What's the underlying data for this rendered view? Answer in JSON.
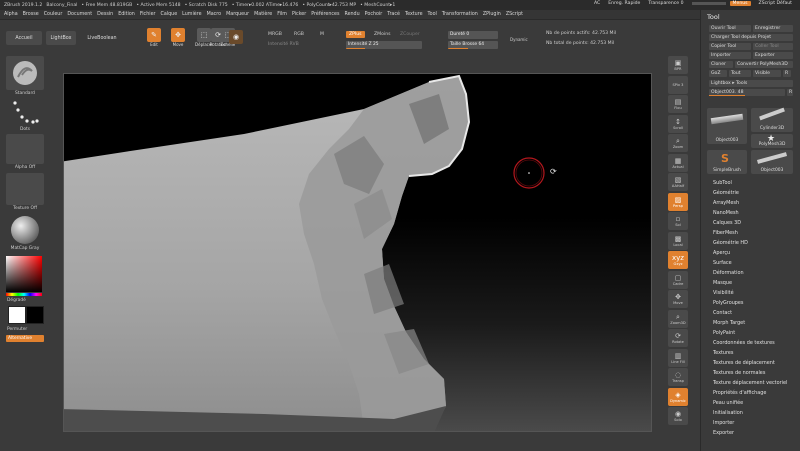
{
  "titlebar": {
    "app": "ZBrush 2019.1.2",
    "doc": "Balcony_Final",
    "free_mem": "• Free Mem 48.819GB",
    "active_mem": "• Active Mem 5148",
    "scratch": "• Scratch Disk 775",
    "timer": "• Timer▸0.002 ATime▸16.476",
    "polycount": "• PolyCount▸42.753 MP",
    "meshcount": "• MeshCount▸1",
    "ac": "AC",
    "quicksave": "Enreg. Rapide",
    "transparence": "Transparence 0",
    "transparence_value": 0,
    "menus": "Menus",
    "zscript": "ZScript Défaut"
  },
  "menubar": [
    "Alpha",
    "Brosse",
    "Couleur",
    "Document",
    "Dessin",
    "Edition",
    "Fichier",
    "Calque",
    "Lumière",
    "Macro",
    "Marqueur",
    "Matière",
    "Film",
    "Picker",
    "Préférences",
    "Rendu",
    "Pochoir",
    "Tracé",
    "Texture",
    "Tool",
    "Transformation",
    "ZPlugin",
    "ZScript"
  ],
  "toolbar": {
    "accueil": "Accueil",
    "lightbox": "LightBox",
    "livebool": "LiveBoolean",
    "icons": [
      {
        "label": "Edit",
        "glyph": "✎",
        "active": true
      },
      {
        "label": "Move",
        "glyph": "✥",
        "active": true
      },
      {
        "label": "Déplacer",
        "glyph": "⬚",
        "active": false
      },
      {
        "label": "Echelle",
        "glyph": "⬚",
        "active": false
      },
      {
        "label": "Rotation",
        "glyph": "⟳",
        "active": false
      }
    ],
    "mrgb": "MRGB",
    "rgb": "RGB",
    "m": "M",
    "intensite_rgb": "Intensité RVB",
    "zplus": "ZPlus",
    "zmoins": "ZMoins",
    "zcouper": "ZCouper",
    "intensite_z": "Intensité Z 25",
    "intensite_z_value": 0.25,
    "durete": "Dureté 0",
    "durete_value": 0,
    "taille": "Taille Brosse 64",
    "taille_value": 0.4,
    "dynamic": "Dynamic",
    "pts_actifs": "Nb de points actifs: 42.753 Mil",
    "pts_total": "Nb total de points: 42.753 Mil"
  },
  "leftpanel": {
    "standard": "Standard",
    "dots": "Dots",
    "alpha_off": "Alpha Off",
    "texture_off": "Texture Off",
    "matcap": "MatCap Gray",
    "gradient": "Dégradé",
    "permuter": "Permuter",
    "alternative": "Alternative"
  },
  "rightstrip": [
    {
      "label": "BPR",
      "glyph": "▣",
      "active": false
    },
    {
      "label": "SPix 3",
      "glyph": "",
      "active": false
    },
    {
      "label": "Flou",
      "glyph": "▤",
      "active": false
    },
    {
      "label": "Scroll",
      "glyph": "↕",
      "active": false
    },
    {
      "label": "Zoom",
      "glyph": "⌕",
      "active": false
    },
    {
      "label": "Actual",
      "glyph": "▦",
      "active": false
    },
    {
      "label": "AAHalf",
      "glyph": "▧",
      "active": false
    },
    {
      "label": "Persp",
      "glyph": "▨",
      "active": true
    },
    {
      "label": "Sol",
      "glyph": "▫",
      "active": false
    },
    {
      "label": "Local",
      "glyph": "▩",
      "active": false
    },
    {
      "label": "Gxyz",
      "glyph": "xyz",
      "active": true
    },
    {
      "label": "Cadre",
      "glyph": "▢",
      "active": false
    },
    {
      "label": "Move",
      "glyph": "✥",
      "active": false
    },
    {
      "label": "Zoom3D",
      "glyph": "⌕",
      "active": false
    },
    {
      "label": "Rotate",
      "glyph": "⟳",
      "active": false
    },
    {
      "label": "Line Fill",
      "glyph": "▥",
      "active": false
    },
    {
      "label": "Transp",
      "glyph": "◌",
      "active": false
    },
    {
      "label": "Dynamic",
      "glyph": "◈",
      "active": true
    },
    {
      "label": "Solo",
      "glyph": "◉",
      "active": false
    }
  ],
  "toolpanel": {
    "title": "Tool",
    "charger_outil": "Ouvrir Tool",
    "enregistrer": "Enregistrer",
    "charger_projet": "Charger Tool depuis Projet",
    "copier": "Copier Tool",
    "coller": "Coller Tool",
    "importer": "Importer",
    "exporter": "Exporter",
    "cloner": "Cloner",
    "convertir": "Convertir PolyMesh3D",
    "goz": "GoZ",
    "tout": "Tout",
    "visible": "Visible",
    "r": "R",
    "lightbox_tools": "Lightbox ▸ Tools",
    "object_slider": "Object003. 48",
    "object_slider_value": 0.48,
    "thumbs": [
      {
        "label": "Object003"
      },
      {
        "label": "Cylinder3D"
      },
      {
        "label": "PolyMesh3D"
      },
      {
        "label": "SimpleBrush"
      },
      {
        "label": "Object003"
      }
    ],
    "list": [
      "SubTool",
      "Géométrie",
      "ArrayMesh",
      "NanoMesh",
      "Calques 3D",
      "FiberMesh",
      "Géométrie HD",
      "Aperçu",
      "Surface",
      "Déformation",
      "Masque",
      "Visibilité",
      "PolyGroupes",
      "Contact",
      "Morph Target",
      "PolyPaint",
      "Coordonnées de textures",
      "Textures",
      "Textures de déplacement",
      "Textures de normales",
      "Texture déplacement vectoriel",
      "Propriétés d'affichage",
      "Peau unifiée",
      "Initialisation",
      "Importer",
      "Exporter"
    ]
  },
  "colors": {
    "accent": "#e0812f",
    "panel": "#3a3a3a",
    "button": "#4a4a4a",
    "viewport": "#000000",
    "cursor_ring": "#b3171d"
  }
}
